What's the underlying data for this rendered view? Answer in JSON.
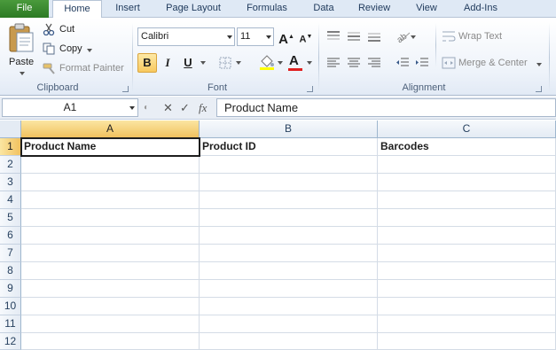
{
  "tabs": [
    "File",
    "Home",
    "Insert",
    "Page Layout",
    "Formulas",
    "Data",
    "Review",
    "View",
    "Add-Ins"
  ],
  "clipboard": {
    "paste_label": "Paste",
    "cut_label": "Cut",
    "copy_label": "Copy",
    "format_painter_label": "Format Painter",
    "group_label": "Clipboard"
  },
  "font": {
    "name": "Calibri",
    "size": "11",
    "grow_label": "A",
    "shrink_label": "A",
    "bold_label": "B",
    "italic_label": "I",
    "underline_label": "U",
    "color_label": "A",
    "group_label": "Font",
    "font_color": "#e02020",
    "fill_color": "#ffff00"
  },
  "alignment": {
    "wrap_text_label": "Wrap Text",
    "merge_center_label": "Merge & Center",
    "group_label": "Alignment"
  },
  "formula_bar": {
    "name_box": "A1",
    "cancel_symbol": "✕",
    "enter_symbol": "✓",
    "fx_label": "fx",
    "value": "Product Name"
  },
  "sheet": {
    "columns": [
      "A",
      "B",
      "C"
    ],
    "rows": [
      "1",
      "2",
      "3",
      "4",
      "5",
      "6",
      "7",
      "8",
      "9",
      "10",
      "11",
      "12"
    ],
    "row1": [
      "Product Name",
      "Product ID",
      "Barcodes"
    ]
  }
}
